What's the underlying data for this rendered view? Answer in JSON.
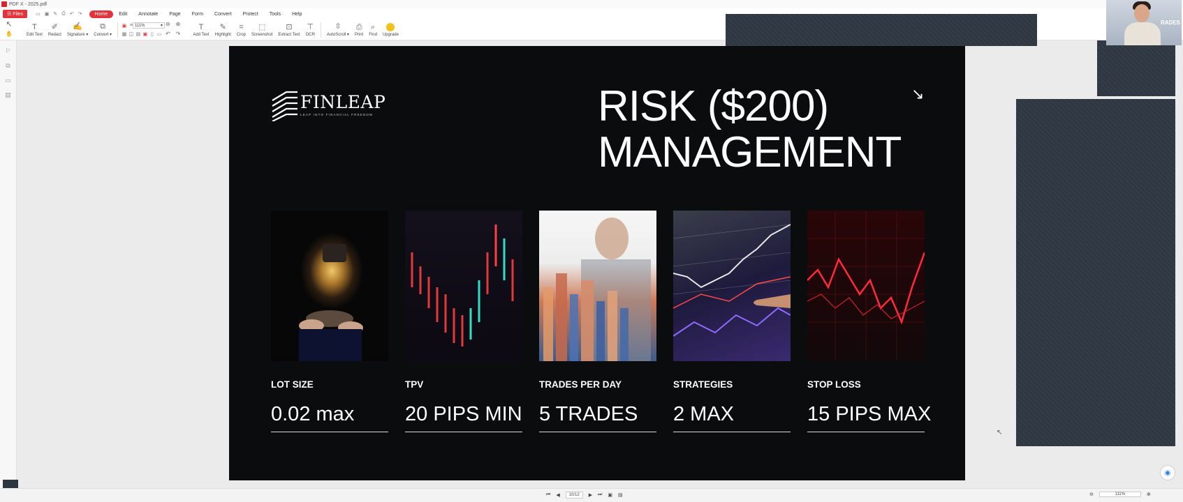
{
  "window": {
    "title": "PDF X - 2025.pdf"
  },
  "menu": {
    "files_label": "Files",
    "items": [
      "Home",
      "Edit",
      "Annotate",
      "Page",
      "Form",
      "Convert",
      "Protect",
      "Tools",
      "Help"
    ],
    "active": "Home"
  },
  "toolbar": {
    "edit_text": "Edit Text",
    "redact": "Redact",
    "signature": "Signature ▾",
    "convert": "Convert ▾",
    "zoom": "111%",
    "add_text": "Add Text",
    "highlight": "Highlight",
    "crop": "Crop",
    "screenshot": "Screenshot",
    "extract_text": "Extract Text",
    "ocr": "OCR",
    "autoscroll": "AutoScroll ▾",
    "print": "Print",
    "find": "Find",
    "upgrade": "Upgrade"
  },
  "slide": {
    "logo_text": "FINLEAP",
    "logo_tagline": "LEAP INTO FINANCIAL FREEDOM",
    "headline_line1": "RISK ($200)",
    "headline_line2": "MANAGEMENT",
    "cards": [
      {
        "label": "LOT SIZE",
        "value": "0.02 max"
      },
      {
        "label": "TPV",
        "value": "20 PIPS MIN"
      },
      {
        "label": "TRADES PER DAY",
        "value": "5 TRADES"
      },
      {
        "label": "STRATEGIES",
        "value": "2 MAX"
      },
      {
        "label": "STOP LOSS",
        "value": "15 PIPS MAX"
      }
    ]
  },
  "webcam": {
    "brand_text": "RADES"
  },
  "statusbar": {
    "page": "10/12",
    "zoom": "111%"
  }
}
